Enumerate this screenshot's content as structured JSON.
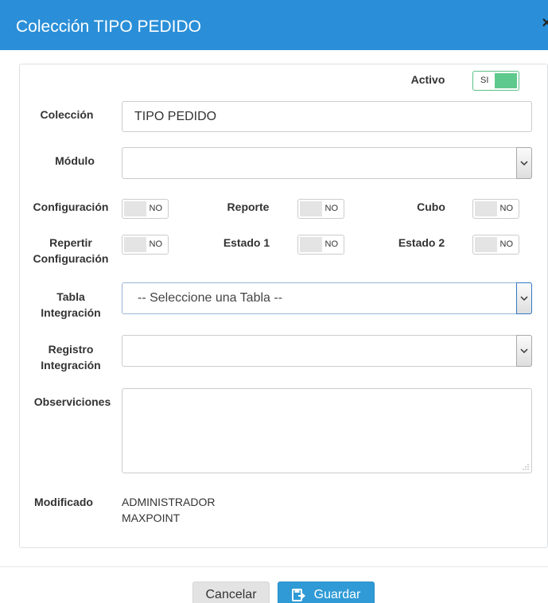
{
  "dialog": {
    "title": "Colección TIPO PEDIDO",
    "close_glyph": "×"
  },
  "form": {
    "activo": {
      "label": "Activo",
      "state": "SI"
    },
    "coleccion": {
      "label": "Colección",
      "value": "TIPO PEDIDO"
    },
    "modulo": {
      "label": "Módulo",
      "value": ""
    },
    "toggles": {
      "configuracion": {
        "label": "Configuración",
        "state": "NO"
      },
      "reporte": {
        "label": "Reporte",
        "state": "NO"
      },
      "cubo": {
        "label": "Cubo",
        "state": "NO"
      },
      "repertir_line1": "Repertir",
      "repertir_line2": "Configuración",
      "repertir": {
        "state": "NO"
      },
      "estado1": {
        "label": "Estado 1",
        "state": "NO"
      },
      "estado2": {
        "label": "Estado 2",
        "state": "NO"
      }
    },
    "tabla_integracion": {
      "label_line1": "Tabla",
      "label_line2": "Integración",
      "value": "-- Seleccione una Tabla --"
    },
    "registro_integracion": {
      "label_line1": "Registro",
      "label_line2": "Integración",
      "value": ""
    },
    "observaciones": {
      "label": "Observiciones",
      "value": ""
    },
    "modificado": {
      "label": "Modificado",
      "value_line1": "ADMINISTRADOR",
      "value_line2": "MAXPOINT"
    }
  },
  "footer": {
    "cancel_label": "Cancelar",
    "save_label": "Guardar"
  },
  "colors": {
    "header": "#2a8fd8",
    "save_button": "#2f9ad6",
    "toggle_on": "#5ec98d"
  }
}
